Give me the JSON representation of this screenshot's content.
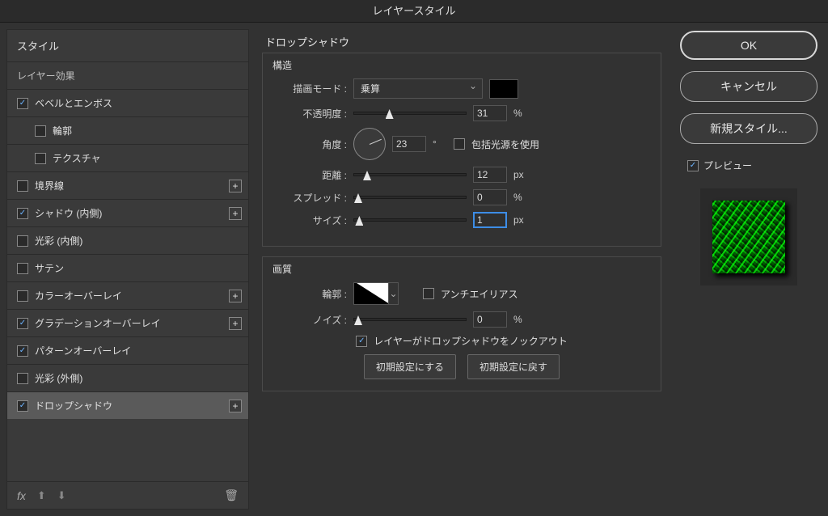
{
  "window_title": "レイヤースタイル",
  "styles_panel": {
    "header": "スタイル",
    "subheader": "レイヤー効果",
    "items": [
      {
        "label": "ベベルとエンボス",
        "checked": true,
        "indent": false,
        "plus": false
      },
      {
        "label": "輪郭",
        "checked": false,
        "indent": true,
        "plus": false
      },
      {
        "label": "テクスチャ",
        "checked": false,
        "indent": true,
        "plus": false
      },
      {
        "label": "境界線",
        "checked": false,
        "indent": false,
        "plus": true
      },
      {
        "label": "シャドウ (内側)",
        "checked": true,
        "indent": false,
        "plus": true
      },
      {
        "label": "光彩 (内側)",
        "checked": false,
        "indent": false,
        "plus": false
      },
      {
        "label": "サテン",
        "checked": false,
        "indent": false,
        "plus": false
      },
      {
        "label": "カラーオーバーレイ",
        "checked": false,
        "indent": false,
        "plus": true
      },
      {
        "label": "グラデーションオーバーレイ",
        "checked": true,
        "indent": false,
        "plus": true
      },
      {
        "label": "パターンオーバーレイ",
        "checked": true,
        "indent": false,
        "plus": false
      },
      {
        "label": "光彩 (外側)",
        "checked": false,
        "indent": false,
        "plus": false
      },
      {
        "label": "ドロップシャドウ",
        "checked": true,
        "indent": false,
        "plus": true,
        "selected": true
      }
    ],
    "footer_fx": "fx"
  },
  "settings": {
    "title": "ドロップシャドウ",
    "structure": {
      "legend": "構造",
      "blend_mode_label": "描画モード :",
      "blend_mode_value": "乗算",
      "color": "#000000",
      "opacity_label": "不透明度 :",
      "opacity_value": "31",
      "opacity_unit": "%",
      "angle_label": "角度 :",
      "angle_value": "23",
      "angle_unit": "°",
      "global_light_label": "包括光源を使用",
      "global_light_checked": false,
      "distance_label": "距離 :",
      "distance_value": "12",
      "distance_unit": "px",
      "spread_label": "スプレッド :",
      "spread_value": "0",
      "spread_unit": "%",
      "size_label": "サイズ :",
      "size_value": "1",
      "size_unit": "px"
    },
    "quality": {
      "legend": "画質",
      "contour_label": "輪郭 :",
      "antialias_label": "アンチエイリアス",
      "antialias_checked": false,
      "noise_label": "ノイズ :",
      "noise_value": "0",
      "noise_unit": "%"
    },
    "knockout_label": "レイヤーがドロップシャドウをノックアウト",
    "knockout_checked": true,
    "make_default_btn": "初期設定にする",
    "reset_default_btn": "初期設定に戻す"
  },
  "side": {
    "ok": "OK",
    "cancel": "キャンセル",
    "new_style": "新規スタイル...",
    "preview_label": "プレビュー",
    "preview_checked": true
  }
}
